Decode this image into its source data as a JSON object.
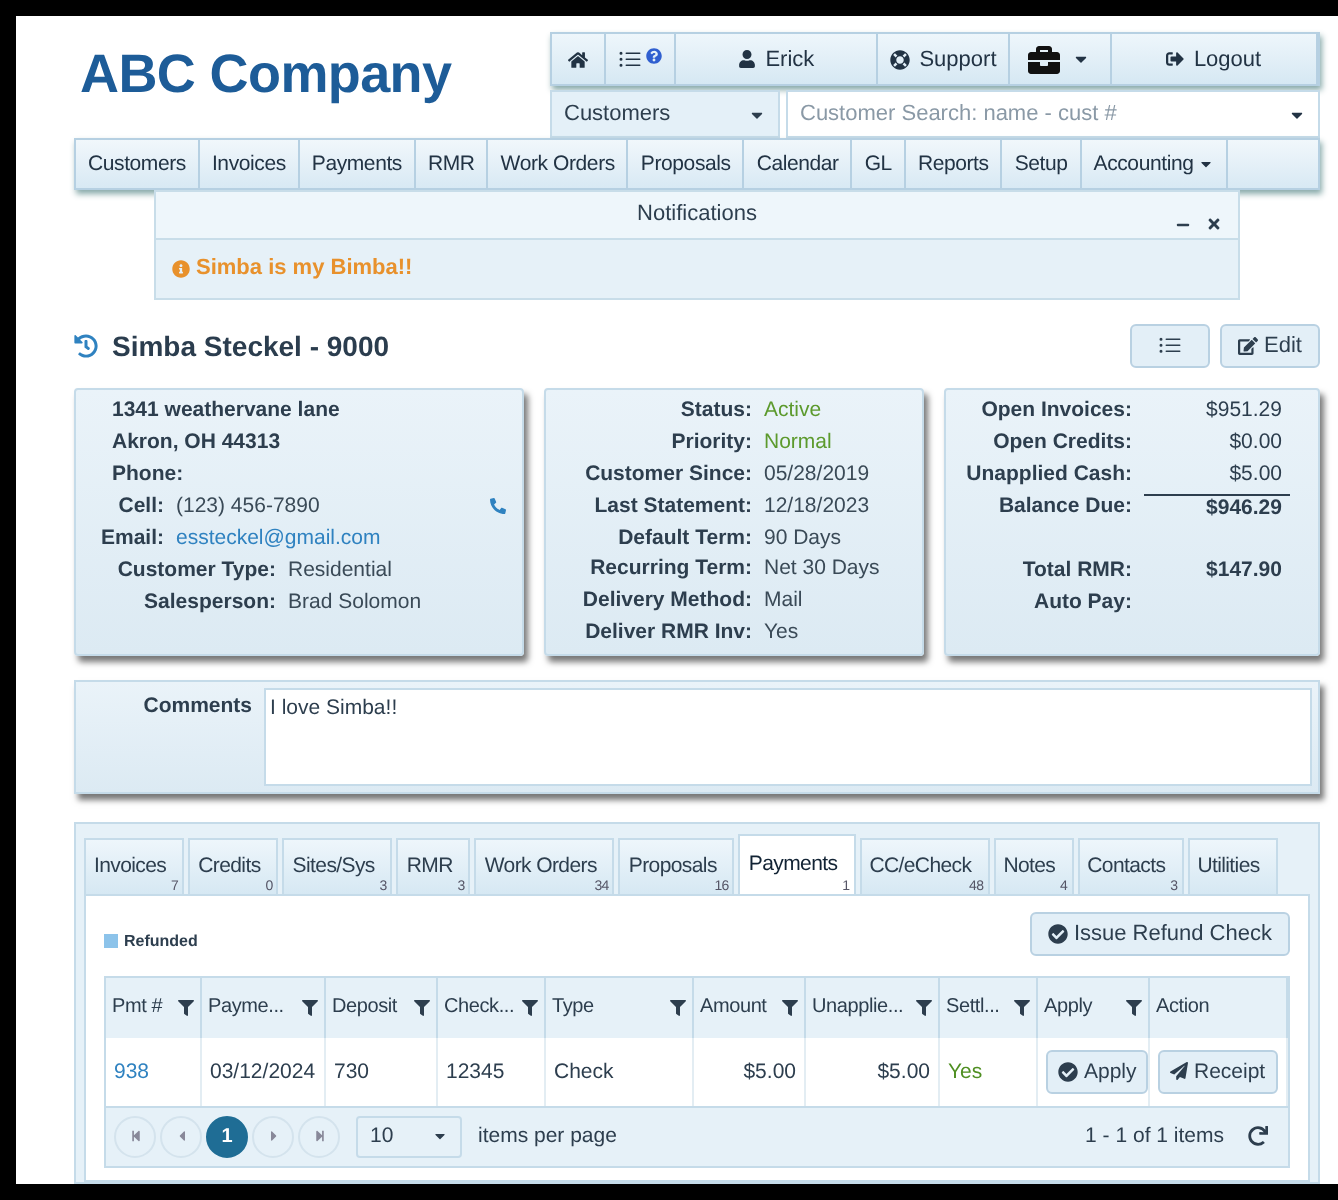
{
  "company": "ABC Company",
  "top_bar": [
    {
      "kind": "home"
    },
    {
      "kind": "list"
    },
    {
      "kind": "user",
      "label": "Erick"
    },
    {
      "kind": "support",
      "label": "Support"
    },
    {
      "kind": "briefcase"
    },
    {
      "kind": "logout",
      "label": "Logout"
    }
  ],
  "search": {
    "module": "Customers",
    "placeholder": "Customer Search: name - cust #"
  },
  "nav": [
    {
      "label": "Customers",
      "dropdown": false
    },
    {
      "label": "Invoices",
      "dropdown": false
    },
    {
      "label": "Payments",
      "dropdown": false
    },
    {
      "label": "RMR",
      "dropdown": false
    },
    {
      "label": "Work Orders",
      "dropdown": false
    },
    {
      "label": "Proposals",
      "dropdown": false
    },
    {
      "label": "Calendar",
      "dropdown": false
    },
    {
      "label": "GL",
      "dropdown": false
    },
    {
      "label": "Reports",
      "dropdown": false
    },
    {
      "label": "Setup",
      "dropdown": false
    },
    {
      "label": "Accounting",
      "dropdown": true
    }
  ],
  "notifications": {
    "title": "Notifications",
    "message": "Simba is my Bimba!!"
  },
  "customer": {
    "title": "Simba Steckel - 9000",
    "edit_label": "Edit"
  },
  "address_card": {
    "lines": [
      "1341 weathervane lane",
      "Akron, OH 44313",
      "Phone:"
    ],
    "rows": [
      {
        "label": "Cell:",
        "value": "(123) 456-7890",
        "kind": "phone"
      },
      {
        "label": "Email:",
        "value": "essteckel@gmail.com",
        "kind": "link"
      },
      {
        "label": "Customer Type:",
        "value": "Residential",
        "kind": "plain"
      },
      {
        "label": "Salesperson:",
        "value": "Brad Solomon",
        "kind": "plain"
      }
    ]
  },
  "status_card": [
    {
      "label": "Status:",
      "value": "Active",
      "kind": "positive"
    },
    {
      "label": "Priority:",
      "value": "Normal",
      "kind": "positive"
    },
    {
      "label": "Customer Since:",
      "value": "05/28/2019",
      "kind": "plain"
    },
    {
      "label": "Last Statement:",
      "value": "12/18/2023",
      "kind": "plain"
    },
    {
      "label": "Default Term:",
      "value": "90 Days",
      "kind": "plain"
    },
    {
      "label": "Recurring Term:",
      "value": "Net 30 Days",
      "kind": "plain"
    },
    {
      "label": "Delivery Method:",
      "value": "Mail",
      "kind": "plain"
    },
    {
      "label": "Deliver RMR Inv:",
      "value": "Yes",
      "kind": "plain"
    }
  ],
  "balance_card": [
    {
      "label": "Open Invoices:",
      "value": "$951.29",
      "kind": "amount"
    },
    {
      "label": "Open Credits:",
      "value": "$0.00",
      "kind": "amount"
    },
    {
      "label": "Unapplied Cash:",
      "value": "$5.00",
      "kind": "amount"
    },
    {
      "label": "Balance Due:",
      "value": "$946.29",
      "kind": "total"
    },
    {
      "label": "Total RMR:",
      "value": "$147.90",
      "kind": "section"
    },
    {
      "label": "Auto Pay:",
      "kind": "amount"
    }
  ],
  "comments": {
    "label": "Comments",
    "value": "I love Simba!!"
  },
  "tabs": [
    {
      "label": "Invoices",
      "count": "7",
      "selected": false
    },
    {
      "label": "Credits",
      "count": "0",
      "selected": false
    },
    {
      "label": "Sites/Sys",
      "count": "3",
      "selected": false
    },
    {
      "label": "RMR",
      "count": "3",
      "selected": false
    },
    {
      "label": "Work Orders",
      "count": "34",
      "selected": false
    },
    {
      "label": "Proposals",
      "count": "16",
      "selected": false
    },
    {
      "label": "Payments",
      "count": "1",
      "selected": true
    },
    {
      "label": "CC/eCheck",
      "count": "48",
      "selected": false
    },
    {
      "label": "Notes",
      "count": "4",
      "selected": false
    },
    {
      "label": "Contacts",
      "count": "3",
      "selected": false
    },
    {
      "label": "Utilities",
      "selected": false
    }
  ],
  "legend": "Refunded",
  "refund_button": "Issue Refund Check",
  "table": {
    "columns": [
      {
        "label": "Pmt #",
        "filter": true
      },
      {
        "label": "Payme...",
        "filter": true
      },
      {
        "label": "Deposit",
        "filter": true
      },
      {
        "label": "Check...",
        "filter": true
      },
      {
        "label": "Type",
        "filter": true
      },
      {
        "label": "Amount",
        "filter": true
      },
      {
        "label": "Unapplie...",
        "filter": true
      },
      {
        "label": "Settl...",
        "filter": true
      },
      {
        "label": "Apply",
        "filter": true
      },
      {
        "label": "Action",
        "filter": false
      }
    ],
    "rows": [
      {
        "pmt": "938",
        "payment_date": "03/12/2024",
        "deposit": "730",
        "check": "12345",
        "type": "Check",
        "amount": "$5.00",
        "unapplied": "$5.00",
        "settled": "Yes",
        "apply_button": "Apply",
        "receipt_button": "Receipt"
      }
    ]
  },
  "pager": {
    "pages": [
      {
        "label": "1",
        "selected": true
      }
    ],
    "page_size": "10",
    "page_size_label": "items per page",
    "summary": "1 - 1 of 1 items"
  }
}
